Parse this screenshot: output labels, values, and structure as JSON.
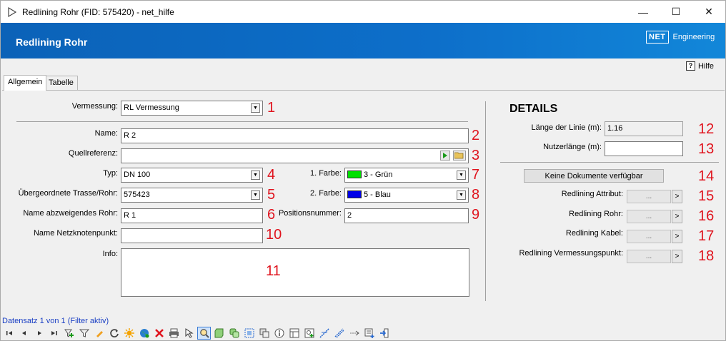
{
  "window": {
    "title": "Redlining Rohr (FID: 575420) - net_hilfe",
    "minimize": "—",
    "maximize": "☐",
    "close": "✕"
  },
  "header": {
    "title": "Redlining Rohr",
    "logo_box": "NET",
    "logo_text": "Engineering",
    "help": "Hilfe",
    "help_icon": "?"
  },
  "tabs": [
    {
      "label": "Allgemein",
      "active": true
    },
    {
      "label": "Tabelle",
      "active": false
    }
  ],
  "form": {
    "vermessung": {
      "label": "Vermessung:",
      "value": "RL Vermessung",
      "num": "1"
    },
    "name": {
      "label": "Name:",
      "value": "R 2",
      "num": "2"
    },
    "quellreferenz": {
      "label": "Quellreferenz:",
      "value": "",
      "num": "3"
    },
    "typ": {
      "label": "Typ:",
      "value": "DN 100",
      "num": "4"
    },
    "trasse": {
      "label": "Übergeordnete Trasse/Rohr:",
      "value": "575423",
      "num": "5"
    },
    "abzweig": {
      "label": "Name abzweigendes Rohr:",
      "value": "R 1",
      "num": "6"
    },
    "farbe1": {
      "label": "1. Farbe:",
      "value": "3 - Grün",
      "color": "#00e000",
      "num": "7"
    },
    "farbe2": {
      "label": "2. Farbe:",
      "value": "5 - Blau",
      "color": "#0000e8",
      "num": "8"
    },
    "position": {
      "label": "Positionsnummer:",
      "value": "2",
      "num": "9"
    },
    "netzknoten": {
      "label": "Name Netzknotenpunkt:",
      "value": "",
      "num": "10"
    },
    "info": {
      "label": "Info:",
      "value": "",
      "num": "11"
    }
  },
  "details": {
    "title": "DETAILS",
    "laenge": {
      "label": "Länge der Linie (m):",
      "value": "1.16",
      "num": "12"
    },
    "nutzer": {
      "label": "Nutzerlänge (m):",
      "value": "",
      "num": "13"
    },
    "docs": {
      "label": "Keine Dokumente verfügbar",
      "num": "14"
    },
    "links": [
      {
        "label": "Redlining Attribut:",
        "dots": "...",
        "go": ">",
        "num": "15"
      },
      {
        "label": "Redlining Rohr:",
        "dots": "...",
        "go": ">",
        "num": "16"
      },
      {
        "label": "Redlining Kabel:",
        "dots": "...",
        "go": ">",
        "num": "17"
      },
      {
        "label": "Redlining Vermessungspunkt:",
        "dots": "...",
        "go": ">",
        "num": "18"
      }
    ]
  },
  "status": "Datensatz 1 von 1 (Filter aktiv)",
  "toolbar": [
    "first-icon",
    "prev-icon",
    "next-icon",
    "last-icon",
    "add-filter-icon",
    "filter-icon",
    "edit-icon",
    "refresh-icon",
    "highlight-icon",
    "globe-icon",
    "delete-icon",
    "print-icon",
    "select-icon",
    "zoom-icon",
    "layer-icon",
    "copy-icon",
    "frame-icon",
    "duplicate-icon",
    "info-icon",
    "table-icon",
    "attach-icon",
    "add-line-icon",
    "split-icon",
    "merge-icon",
    "list-icon",
    "exit-icon"
  ]
}
